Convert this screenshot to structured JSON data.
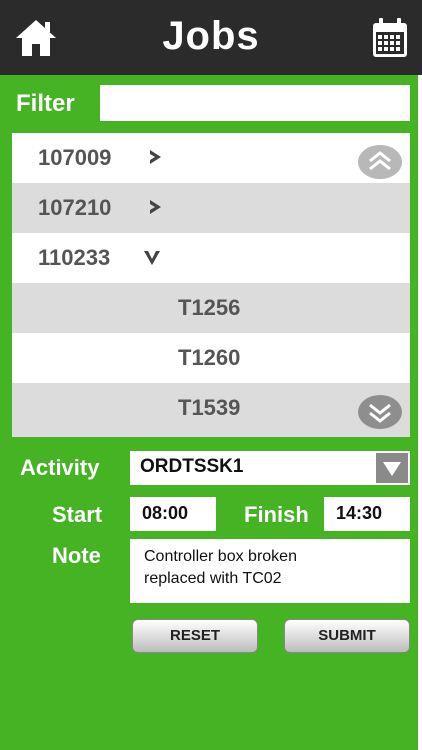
{
  "header": {
    "title": "Jobs",
    "home_icon": "home-icon",
    "calendar_icon": "calendar-icon"
  },
  "filter": {
    "label": "Filter",
    "value": "",
    "placeholder": ""
  },
  "jobs_list": {
    "rows": [
      {
        "id": "107009",
        "state": "collapsed"
      },
      {
        "id": "107210",
        "state": "collapsed"
      },
      {
        "id": "110233",
        "state": "expanded"
      },
      {
        "id": "T1256",
        "state": "child"
      },
      {
        "id": "T1260",
        "state": "child"
      },
      {
        "id": "T1539",
        "state": "child"
      }
    ]
  },
  "form": {
    "activity_label": "Activity",
    "activity_value": "ORDTSSK1",
    "start_label": "Start",
    "start_value": "08:00",
    "finish_label": "Finish",
    "finish_value": "14:30",
    "note_label": "Note",
    "note_lines": [
      "Controller box broken",
      "replaced with TC02"
    ]
  },
  "buttons": {
    "reset": "RESET",
    "submit": "SUBMIT"
  },
  "colors": {
    "header_bg": "#2b2b2b",
    "accent_green": "#45b324",
    "row_alt": "#dcdcdc"
  }
}
